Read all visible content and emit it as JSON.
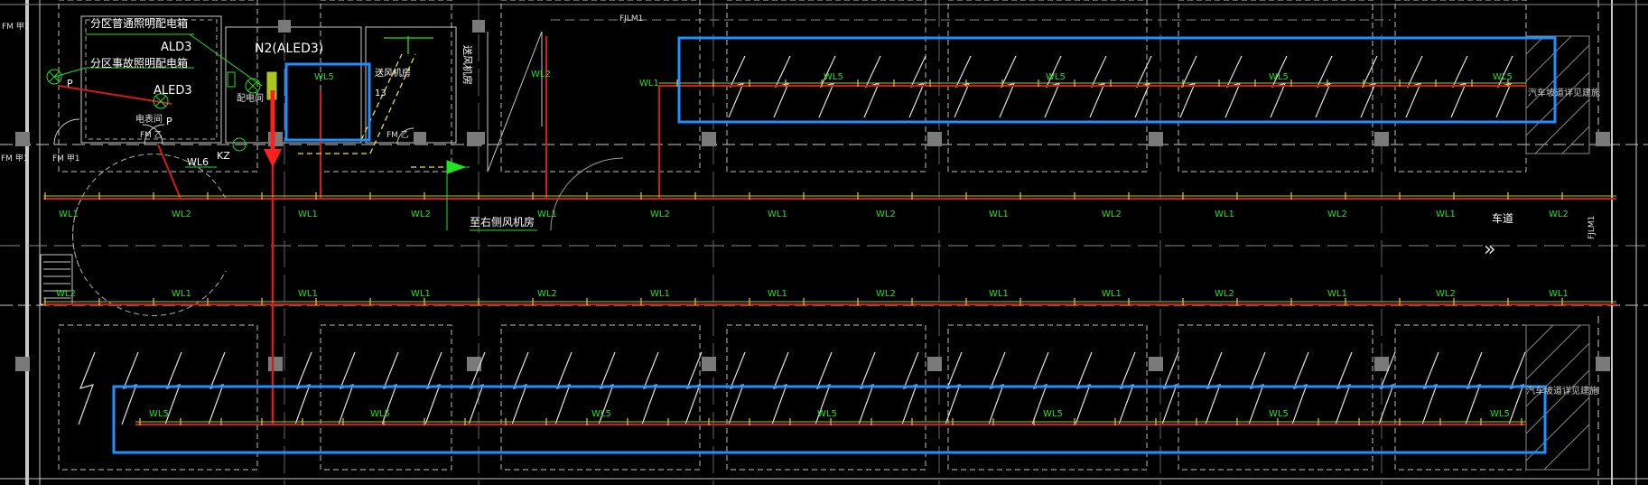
{
  "drawing": {
    "labels": {
      "zone_power_box": "分区普通照明配电箱",
      "zone_emergency_box": "分区事故照明配电箱",
      "ald3": "ALD3",
      "aled3": "ALED3",
      "n2": "N2(ALED3)",
      "wl6": "WL6",
      "kz": "KZ",
      "fm1": "FM 甲1",
      "fm2": "FM 甲1",
      "fm3": "FM 甲1",
      "fm_z": "FM 乙",
      "fm_z2": "FM 乙",
      "elec_room": "电表间",
      "dist_room": "配电间",
      "p1": "P",
      "p2": "P",
      "supply_fan": "送风机房",
      "supply_fan2": "送风机房",
      "fan_qty": "13",
      "fjlm1": "FJLM1",
      "fjlm2": "FJLM1",
      "to_fan_room": "至右侧风机房",
      "lane": "车道",
      "ramp_note_top": "汽车坡道详见建施",
      "ramp_note_bottom": "汽车坡道详见建施"
    },
    "wl5_top": [
      "WL5",
      "WL5",
      "WL5",
      "WL5",
      "WL5",
      "WL5"
    ],
    "wl5_box": "WL5",
    "wl5_bottom": [
      "WL5",
      "WL5",
      "WL5",
      "WL5",
      "WL5",
      "WL5",
      "WL5"
    ],
    "wl_vertical": [
      "WL2",
      "WL1"
    ],
    "row1_circuits": [
      "WL1",
      "WL2",
      "WL1",
      "WL2",
      "WL1",
      "WL2",
      "WL1",
      "WL2",
      "WL1",
      "WL2",
      "WL1",
      "WL2",
      "WL1",
      "WL2"
    ],
    "row2_circuits": [
      "WL2",
      "WL1",
      "WL1",
      "WL1",
      "WL2",
      "WL1",
      "WL1",
      "WL2",
      "WL1",
      "WL1",
      "WL2",
      "WL1",
      "WL2",
      "WL1"
    ],
    "colors": {
      "background": "#000000",
      "wire_red": "#d41a1a",
      "wire_yellow_green": "#a8c81e",
      "text_green": "#22e022",
      "highlight_blue": "#1e90ff",
      "grid_white": "#c8c8c8",
      "dashed_yellow": "#f0e030",
      "arrow_red": "#ff2020",
      "column_gray": "#7a7a7a"
    }
  }
}
